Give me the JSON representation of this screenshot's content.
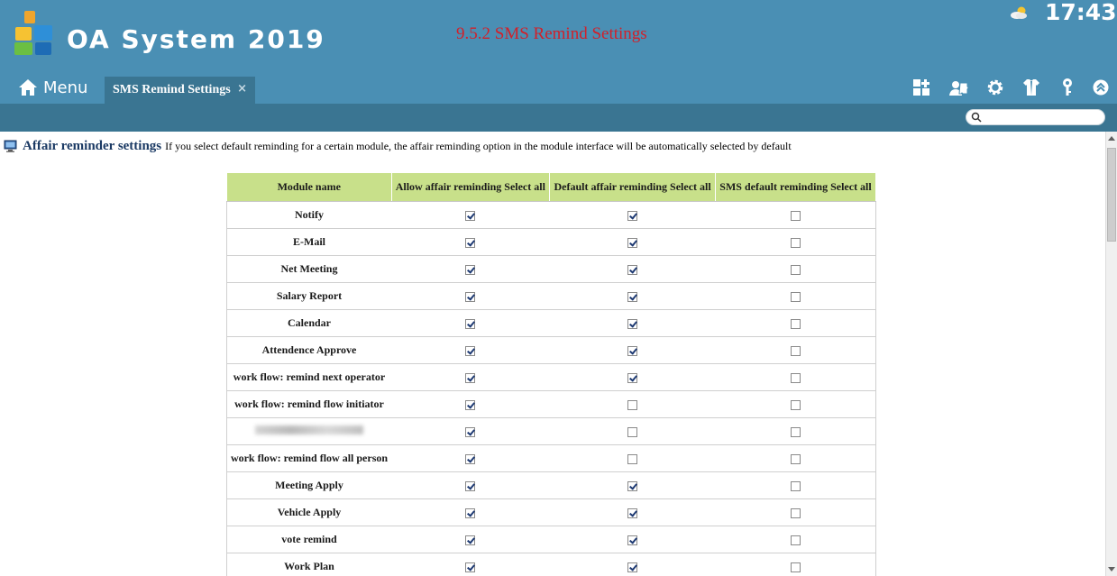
{
  "header": {
    "app_title": "OA System 2019",
    "page_heading": "9.5.2 SMS Remind Settings",
    "clock": "17:43",
    "menu_label": "Menu"
  },
  "tab": {
    "label": "SMS Remind Settings",
    "close": "×"
  },
  "toolbar_icons": [
    "add-module-icon",
    "user-puzzle-icon",
    "settings-gear-icon",
    "shirt-icon",
    "key-icon",
    "collapse-up-icon"
  ],
  "search": {
    "placeholder": "",
    "value": ""
  },
  "info": {
    "title": "Affair reminder settings",
    "description": "If you select default reminding for a certain module, the affair reminding option in the module interface will be automatically selected by default"
  },
  "table": {
    "headers": [
      "Module name",
      "Allow affair reminding Select all",
      "Default affair reminding Select all",
      "SMS default reminding Select all"
    ],
    "rows": [
      {
        "name": "Notify",
        "allow": true,
        "default": true,
        "sms": false
      },
      {
        "name": "E-Mail",
        "allow": true,
        "default": true,
        "sms": false
      },
      {
        "name": "Net Meeting",
        "allow": true,
        "default": true,
        "sms": false
      },
      {
        "name": "Salary Report",
        "allow": true,
        "default": true,
        "sms": false
      },
      {
        "name": "Calendar",
        "allow": true,
        "default": true,
        "sms": false
      },
      {
        "name": "Attendence Approve",
        "allow": true,
        "default": true,
        "sms": false
      },
      {
        "name": "work flow: remind next operator",
        "allow": true,
        "default": true,
        "sms": false
      },
      {
        "name": "work flow: remind flow initiator",
        "allow": true,
        "default": false,
        "sms": false
      },
      {
        "name": "",
        "blurred": true,
        "allow": true,
        "default": false,
        "sms": false
      },
      {
        "name": "work flow: remind flow all person",
        "allow": true,
        "default": false,
        "sms": false
      },
      {
        "name": "Meeting Apply",
        "allow": true,
        "default": true,
        "sms": false
      },
      {
        "name": "Vehicle Apply",
        "allow": true,
        "default": true,
        "sms": false
      },
      {
        "name": "vote remind",
        "allow": true,
        "default": true,
        "sms": false
      },
      {
        "name": "Work Plan",
        "allow": true,
        "default": true,
        "sms": false
      }
    ]
  },
  "colors": {
    "header_bg": "#4a8fb4",
    "subbar_bg": "#3a7592",
    "heading_red": "#d2202a",
    "table_header_bg": "#c8e08a"
  }
}
